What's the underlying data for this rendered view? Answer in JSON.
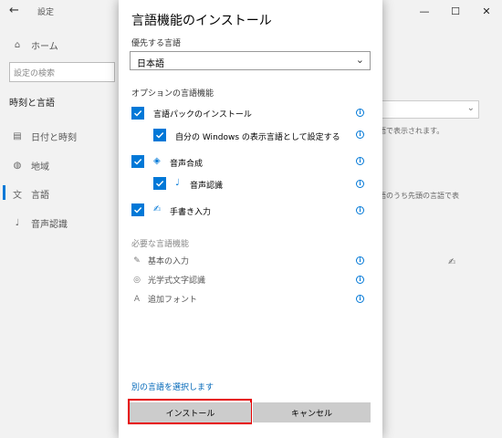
{
  "background_window": {
    "title": "設定",
    "back_icon": "back-arrow-icon",
    "controls": [
      "minimize-icon",
      "maximize-icon",
      "close-icon"
    ],
    "nav": {
      "home": "ホーム",
      "search_placeholder": "設定の検索",
      "section": "時刻と言語",
      "items": [
        {
          "label": "日付と時刻",
          "icon": "calendar-icon"
        },
        {
          "label": "地域",
          "icon": "globe-icon"
        },
        {
          "label": "言語",
          "icon": "language-icon",
          "active": true
        },
        {
          "label": "音声認識",
          "icon": "microphone-icon"
        }
      ]
    },
    "right_text_1": "語で表示されます。",
    "right_text_2": "語のうち先頭の言語で表"
  },
  "dialog": {
    "title": "言語機能のインストール",
    "preferred_label": "優先する言語",
    "language_select": "日本語",
    "optional_label": "オプションの言語機能",
    "optional_features": [
      {
        "label": "言語パックのインストール",
        "checked": true,
        "indent": 0,
        "icon": ""
      },
      {
        "label": "自分の Windows の表示言語として設定する",
        "checked": true,
        "indent": 1,
        "icon": ""
      },
      {
        "label": "音声合成",
        "checked": true,
        "indent": 0,
        "icon": "text-to-speech-icon"
      },
      {
        "label": "音声認識",
        "checked": true,
        "indent": 1,
        "icon": "microphone-icon"
      },
      {
        "label": "手書き入力",
        "checked": true,
        "indent": 0,
        "icon": "handwriting-icon"
      }
    ],
    "required_label": "必要な言語機能",
    "required_features": [
      {
        "label": "基本の入力",
        "icon": "basic-typing-icon"
      },
      {
        "label": "光学式文字認識",
        "icon": "ocr-icon"
      },
      {
        "label": "追加フォント",
        "icon": "fonts-icon"
      }
    ],
    "other_language_link": "別の言語を選択します",
    "install_button": "インストール",
    "cancel_button": "キャンセル",
    "highlight_color": "#e60000",
    "accent_color": "#0078d7"
  }
}
